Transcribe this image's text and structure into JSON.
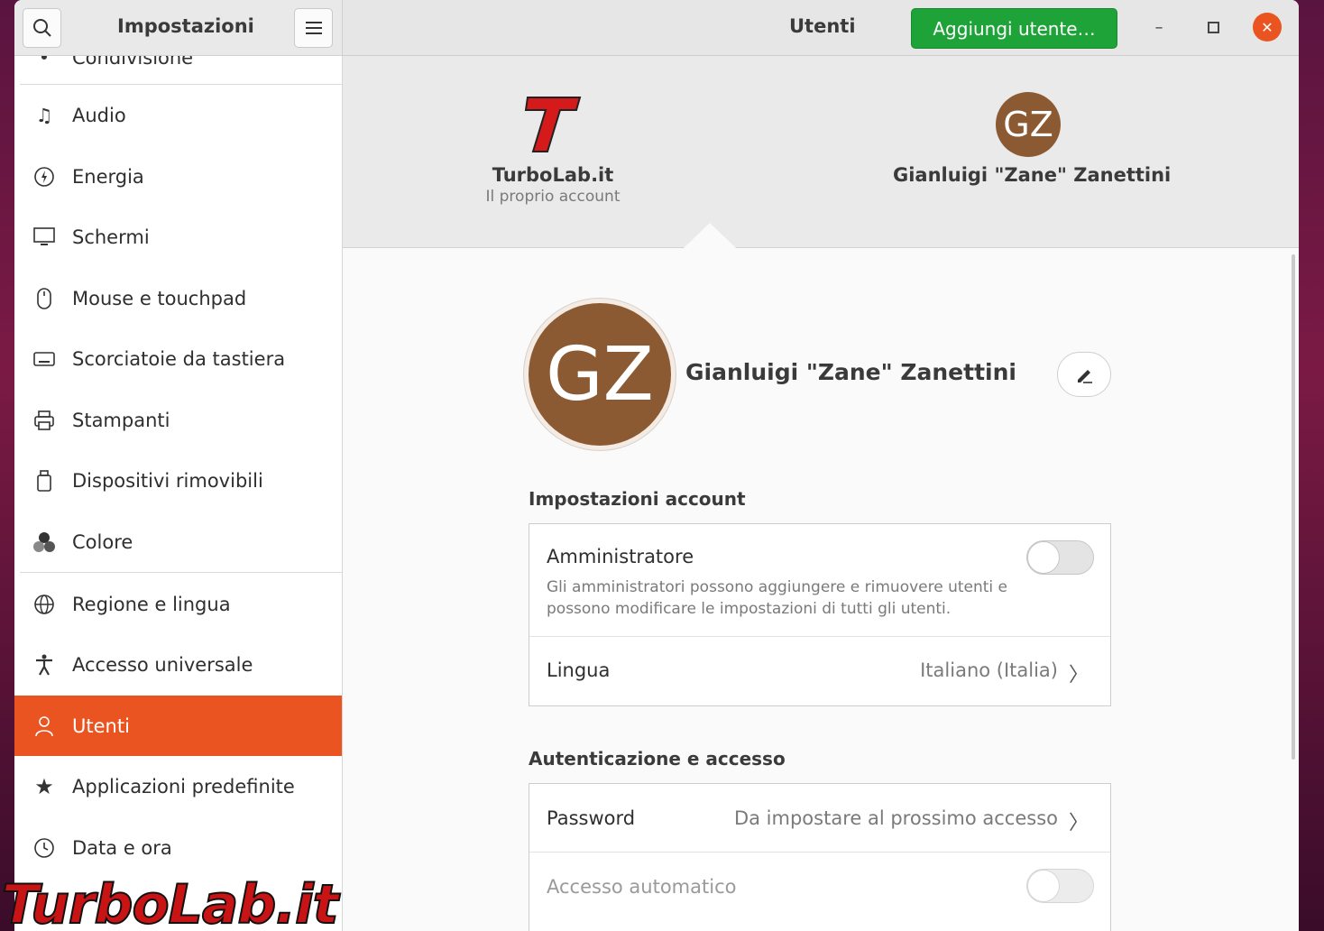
{
  "header": {
    "sidebar_title": "Impostazioni",
    "page_title": "Utenti",
    "add_user_label": "Aggiungi utente…",
    "search_icon": "search-icon",
    "menu_icon": "hamburger-icon"
  },
  "sidebar": {
    "partial_top_label": "Condivisione",
    "items": [
      {
        "label": "Audio",
        "icon": "music-note-icon"
      },
      {
        "label": "Energia",
        "icon": "power-icon"
      },
      {
        "label": "Schermi",
        "icon": "display-icon"
      },
      {
        "label": "Mouse e touchpad",
        "icon": "mouse-icon"
      },
      {
        "label": "Scorciatoie da tastiera",
        "icon": "keyboard-icon"
      },
      {
        "label": "Stampanti",
        "icon": "printer-icon"
      },
      {
        "label": "Dispositivi rimovibili",
        "icon": "usb-drive-icon"
      },
      {
        "label": "Colore",
        "icon": "color-icon"
      },
      {
        "label": "Regione e lingua",
        "icon": "globe-icon"
      },
      {
        "label": "Accesso universale",
        "icon": "accessibility-icon"
      },
      {
        "label": "Utenti",
        "icon": "user-icon"
      },
      {
        "label": "Applicazioni predefinite",
        "icon": "star-icon"
      },
      {
        "label": "Data e ora",
        "icon": "clock-icon"
      }
    ],
    "active_label": "Utenti"
  },
  "users": [
    {
      "name": "TurboLab.it",
      "subtitle": "Il proprio account",
      "logo_letter": "T"
    },
    {
      "name": "Gianluigi \"Zane\" Zanettini",
      "initials": "GZ"
    }
  ],
  "selected_user": {
    "initials": "GZ",
    "name": "Gianluigi \"Zane\" Zanettini"
  },
  "account_settings": {
    "title": "Impostazioni account",
    "admin_label": "Amministratore",
    "admin_desc": "Gli amministratori possono aggiungere e rimuovere utenti e possono modificare le impostazioni di tutti gli utenti.",
    "admin_enabled": false,
    "language_label": "Lingua",
    "language_value": "Italiano (Italia)"
  },
  "auth": {
    "title": "Autenticazione e accesso",
    "password_label": "Password",
    "password_value": "Da impostare al prossimo accesso",
    "autologin_label": "Accesso automatico",
    "autologin_enabled": false
  },
  "watermark": "TurboLab.it",
  "colors": {
    "accent": "#e95420",
    "add_button": "#1ea339",
    "avatar": "#8b5a32"
  }
}
